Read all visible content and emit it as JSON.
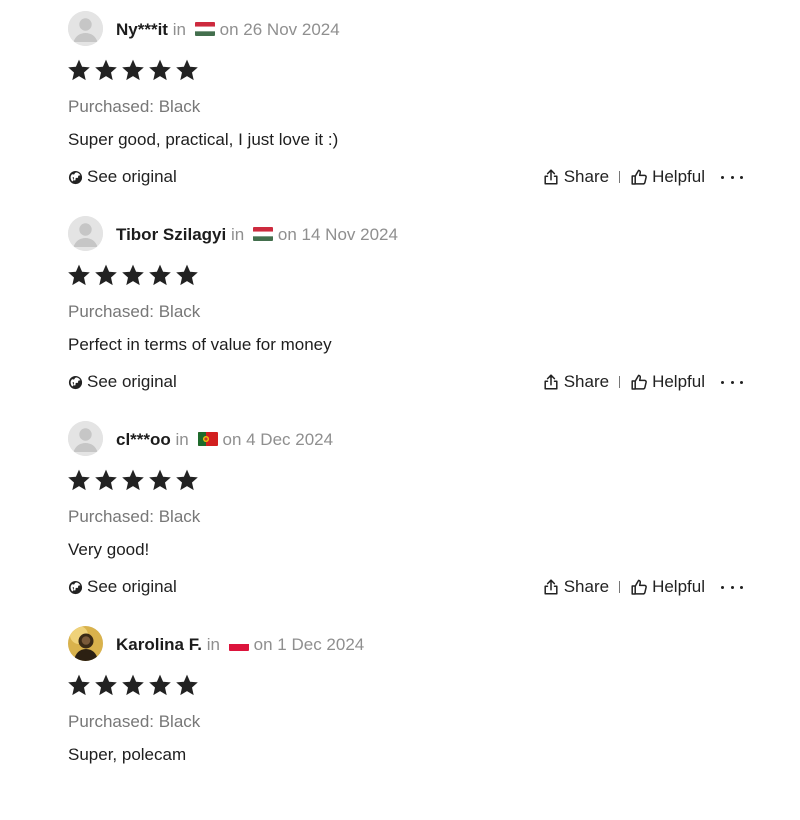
{
  "colors": {
    "text": "#222222",
    "muted": "#8f8f8f",
    "star": "#222222"
  },
  "reviews": [
    {
      "reviewer": "Ny***it",
      "in_label": "in",
      "flag": "hungary-flag",
      "date": "on 26 Nov 2024",
      "rating": 5,
      "purchased": "Purchased: Black",
      "text": "Super good, practical, I just love it :)",
      "see_original": "See original",
      "share": "Share",
      "helpful": "Helpful"
    },
    {
      "reviewer": "Tibor Szilagyi",
      "in_label": "in",
      "flag": "hungary-flag",
      "date": "on 14 Nov 2024",
      "rating": 5,
      "purchased": "Purchased: Black",
      "text": "Perfect in terms of value for money",
      "see_original": "See original",
      "share": "Share",
      "helpful": "Helpful"
    },
    {
      "reviewer": "cl***oo",
      "in_label": "in",
      "flag": "portugal-flag",
      "date": "on 4 Dec 2024",
      "rating": 5,
      "purchased": "Purchased: Black",
      "text": "Very good!",
      "see_original": "See original",
      "share": "Share",
      "helpful": "Helpful"
    },
    {
      "reviewer": "Karolina F.",
      "in_label": "in",
      "flag": "poland-flag",
      "date": "on 1 Dec 2024",
      "rating": 5,
      "purchased": "Purchased: Black",
      "text": "Super, polecam"
    }
  ]
}
